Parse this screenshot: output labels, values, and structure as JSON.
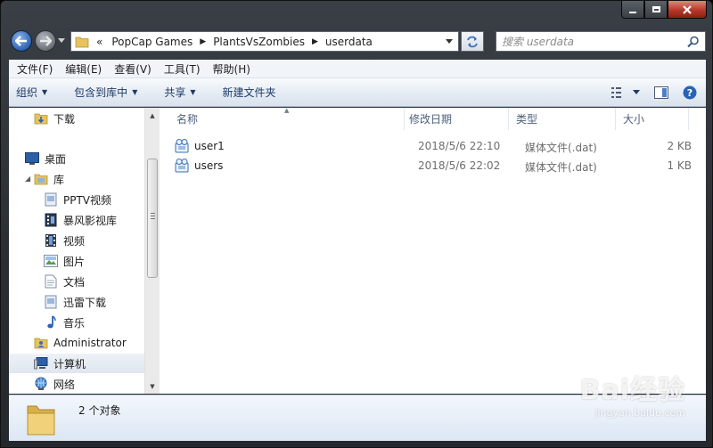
{
  "address": {
    "chevrons": "«",
    "crumbs": [
      "PopCap Games",
      "PlantsVsZombies",
      "userdata"
    ]
  },
  "search": {
    "placeholder": "搜索 userdata"
  },
  "menu": [
    "文件(F)",
    "编辑(E)",
    "查看(V)",
    "工具(T)",
    "帮助(H)"
  ],
  "commands": {
    "organize": "组织",
    "include_library": "包含到库中",
    "share": "共享",
    "new_folder": "新建文件夹"
  },
  "nav": {
    "downloads": "下载",
    "desktop": "桌面",
    "library": "库",
    "pptv": "PPTV视频",
    "baofeng": "暴风影视库",
    "videos": "视频",
    "pictures": "图片",
    "documents": "文档",
    "xunlei": "迅雷下载",
    "music": "音乐",
    "administrator": "Administrator",
    "computer": "计算机",
    "network": "网络"
  },
  "columns": {
    "name": "名称",
    "modified": "修改日期",
    "type": "类型",
    "size": "大小"
  },
  "files": [
    {
      "name": "user1",
      "modified": "2018/5/6 22:10",
      "type": "媒体文件(.dat)",
      "size": "2 KB"
    },
    {
      "name": "users",
      "modified": "2018/5/6 22:02",
      "type": "媒体文件(.dat)",
      "size": "1 KB"
    }
  ],
  "details": {
    "count": "2 个对象"
  },
  "watermark": {
    "brand": "Bai经验",
    "url": "jingyan.baidu.com"
  },
  "colors": {
    "title_bar": "#2a2e33",
    "close_button": "#b5382a",
    "command_text": "#1e3b66"
  },
  "icons": [
    "back-arrow-icon",
    "forward-arrow-icon",
    "folder-icon",
    "refresh-icon",
    "search-icon",
    "view-options-icon",
    "preview-pane-icon",
    "help-icon",
    "media-file-icon"
  ]
}
